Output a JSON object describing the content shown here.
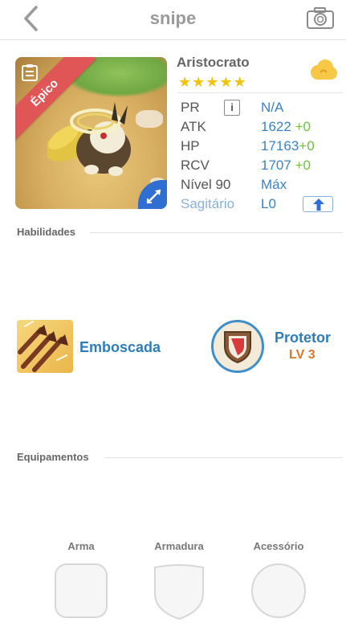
{
  "header": {
    "title": "snipe"
  },
  "hero": {
    "rarity": "Épico",
    "name": "Aristocrato",
    "stars": "★★★★★",
    "stats": [
      {
        "label": "PR",
        "value": "N/A",
        "bonus": ""
      },
      {
        "label": "ATK",
        "value": "1622",
        "bonus": "+0"
      },
      {
        "label": "HP",
        "value": "17163",
        "bonus": "+0"
      },
      {
        "label": "RCV",
        "value": "1707",
        "bonus": "+0"
      },
      {
        "label": "Nível 90",
        "value": "Máx",
        "bonus": ""
      },
      {
        "label": "Sagitário",
        "value": "L0",
        "bonus": ""
      }
    ],
    "info_icon": "i"
  },
  "skills": {
    "section_title": "Habilidades",
    "active": {
      "name": "Emboscada"
    },
    "passive": {
      "name": "Protetor",
      "level": "LV 3"
    }
  },
  "equipment": {
    "section_title": "Equipamentos",
    "slots": [
      {
        "label": "Arma"
      },
      {
        "label": "Armadura"
      },
      {
        "label": "Acessório"
      }
    ]
  },
  "colors": {
    "accent": "#3b82c4",
    "bonus": "#6fbf3a",
    "star": "#f2c20c",
    "ribbon": "#e05555",
    "level": "#d9772c"
  },
  "icons": [
    "back-chevron-icon",
    "camera-icon",
    "clipboard-icon",
    "archer-role-icon",
    "cloud-icon",
    "info-icon",
    "upgrade-arrow-icon",
    "ambush-arrows-icon",
    "shield-icon"
  ]
}
